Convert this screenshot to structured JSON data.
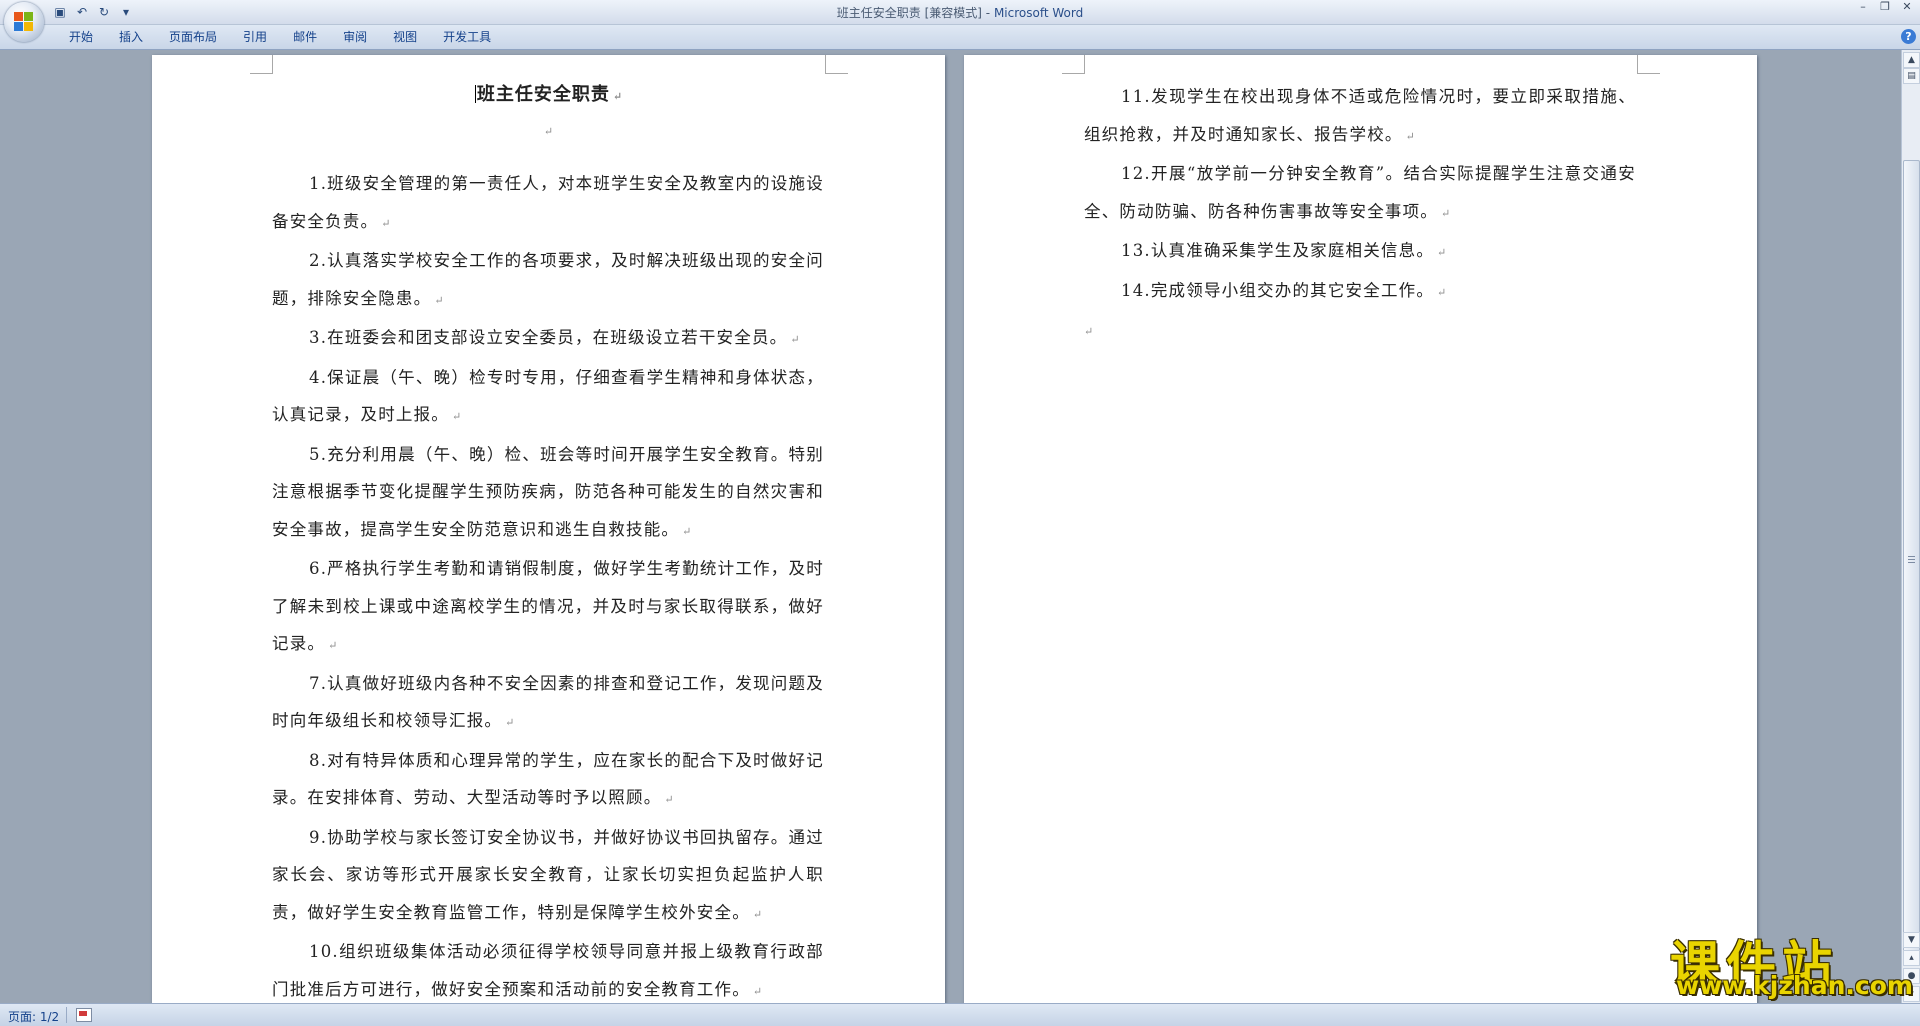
{
  "window": {
    "title_doc": "班主任安全职责 [兼容模式]",
    "title_sep": " - ",
    "title_app": "Microsoft Word"
  },
  "quick_access": [
    {
      "name": "save",
      "glyph": "▣"
    },
    {
      "name": "undo",
      "glyph": "↶"
    },
    {
      "name": "redo",
      "glyph": "↻"
    },
    {
      "name": "customize",
      "glyph": "▾"
    }
  ],
  "window_controls": {
    "minimize": "–",
    "restore": "❐",
    "close": "✕"
  },
  "ribbon": {
    "tabs": [
      "开始",
      "插入",
      "页面布局",
      "引用",
      "邮件",
      "审阅",
      "视图",
      "开发工具"
    ],
    "help": "?"
  },
  "document": {
    "title": "班主任安全职责",
    "para_mark": "↵",
    "page1_paragraphs": [
      "1.班级安全管理的第一责任人，对本班学生安全及教室内的设施设备安全负责。",
      "2.认真落实学校安全工作的各项要求，及时解决班级出现的安全问题，排除安全隐患。",
      "3.在班委会和团支部设立安全委员，在班级设立若干安全员。",
      "4.保证晨（午、晚）检专时专用，仔细查看学生精神和身体状态，认真记录，及时上报。",
      "5.充分利用晨（午、晚）检、班会等时间开展学生安全教育。特别注意根据季节变化提醒学生预防疾病，防范各种可能发生的自然灾害和安全事故，提高学生安全防范意识和逃生自救技能。",
      "6.严格执行学生考勤和请销假制度，做好学生考勤统计工作，及时了解未到校上课或中途离校学生的情况，并及时与家长取得联系，做好记录。",
      "7.认真做好班级内各种不安全因素的排查和登记工作，发现问题及时向年级组长和校领导汇报。",
      "8.对有特异体质和心理异常的学生，应在家长的配合下及时做好记录。在安排体育、劳动、大型活动等时予以照顾。",
      "9.协助学校与家长签订安全协议书，并做好协议书回执留存。通过家长会、家访等形式开展家长安全教育，让家长切实担负起监护人职责，做好学生安全教育监管工作，特别是保障学生校外安全。",
      "10.组织班级集体活动必须征得学校领导同意并报上级教育行政部门批准后方可进行，做好安全预案和活动前的安全教育工作。"
    ],
    "page2_paragraphs": [
      "11.发现学生在校出现身体不适或危险情况时，要立即采取措施、组织抢救，并及时通知家长、报告学校。",
      "12.开展“放学前一分钟安全教育”。结合实际提醒学生注意交通安全、防动防骗、防各种伤害事故等安全事项。",
      "13.认真准确采集学生及家庭相关信息。",
      "14.完成领导小组交办的其它安全工作。"
    ]
  },
  "status": {
    "page": "页面: 1/2"
  },
  "watermark": {
    "cn": "课件站",
    "en": "www.kjzhan.com"
  },
  "colors": {
    "accent": "#15428b",
    "watermark": "#e9d400"
  }
}
